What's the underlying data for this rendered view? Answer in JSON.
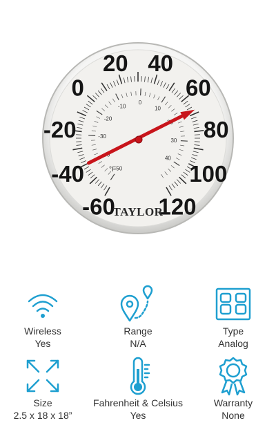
{
  "product": {
    "name": "Thermometer",
    "brand": "TAYLOR",
    "unit_mark": "°F",
    "outer_scale": [
      "-60",
      "-40",
      "-20",
      "0",
      "20",
      "40",
      "60",
      "80",
      "100",
      "120"
    ],
    "inner_scale": [
      "-50",
      "-40",
      "-30",
      "-20",
      "-10",
      "0",
      "10",
      "20",
      "30",
      "40",
      "50"
    ],
    "needle_value_f": 68
  },
  "specs": [
    {
      "label": "Wireless",
      "value": "Yes",
      "icon": "wifi-icon"
    },
    {
      "label": "Range",
      "value": "N/A",
      "icon": "location-pin-icon"
    },
    {
      "label": "Type",
      "value": "Analog",
      "icon": "digital-display-icon"
    },
    {
      "label": "Size",
      "value": "2.5 x 18 x 18”",
      "icon": "expand-arrows-icon"
    },
    {
      "label": "Fahrenheit & Celsius",
      "value": "Yes",
      "icon": "thermometer-icon"
    },
    {
      "label": "Warranty",
      "value": "None",
      "icon": "award-ribbon-icon"
    }
  ],
  "colors": {
    "icon_accent": "#1e9fd0",
    "needle": "#c8151b",
    "dial": "#f2f1ee"
  }
}
